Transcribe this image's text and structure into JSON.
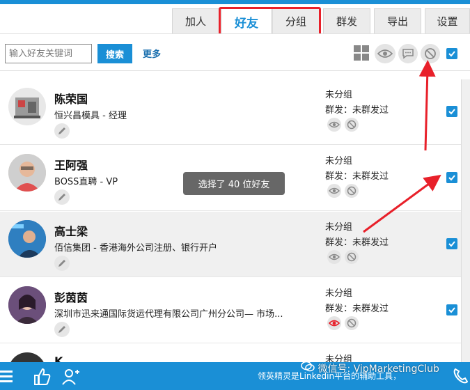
{
  "tabs": [
    {
      "label": "加人"
    },
    {
      "label": "好友"
    },
    {
      "label": "分组"
    },
    {
      "label": "群发"
    },
    {
      "label": "导出"
    },
    {
      "label": "设置"
    }
  ],
  "toolbar": {
    "search_placeholder": "输入好友关键词",
    "search_label": "搜索",
    "more_label": "更多"
  },
  "contacts": [
    {
      "name": "陈荣国",
      "title": "恒兴昌模具 - 经理",
      "group": "未分组",
      "broadcast": "群发：未群发过",
      "checked": true
    },
    {
      "name": "王阿强",
      "title": "BOSS直聘 - VP",
      "group": "未分组",
      "broadcast": "群发：未群发过",
      "checked": true
    },
    {
      "name": "高士梁",
      "title": "佰信集团 - 香港海外公司注册、银行开户",
      "group": "未分组",
      "broadcast": "群发：未群发过",
      "checked": true
    },
    {
      "name": "彭茵茵",
      "title": "深圳市迅来通国际货运代理有限公司广州分公司— 市场...",
      "group": "未分组",
      "broadcast": "群发：未群发过",
      "checked": true
    },
    {
      "name": "K",
      "group": "未分组"
    }
  ],
  "toast": "选择了 40 位好友",
  "footer": {
    "text": "领英精灵是Linkedin平台的辅助工具，",
    "watermark": "微信号: VipMarketingClub"
  },
  "colors": {
    "accent": "#1a8fd6",
    "highlight_red": "#e8202a"
  }
}
